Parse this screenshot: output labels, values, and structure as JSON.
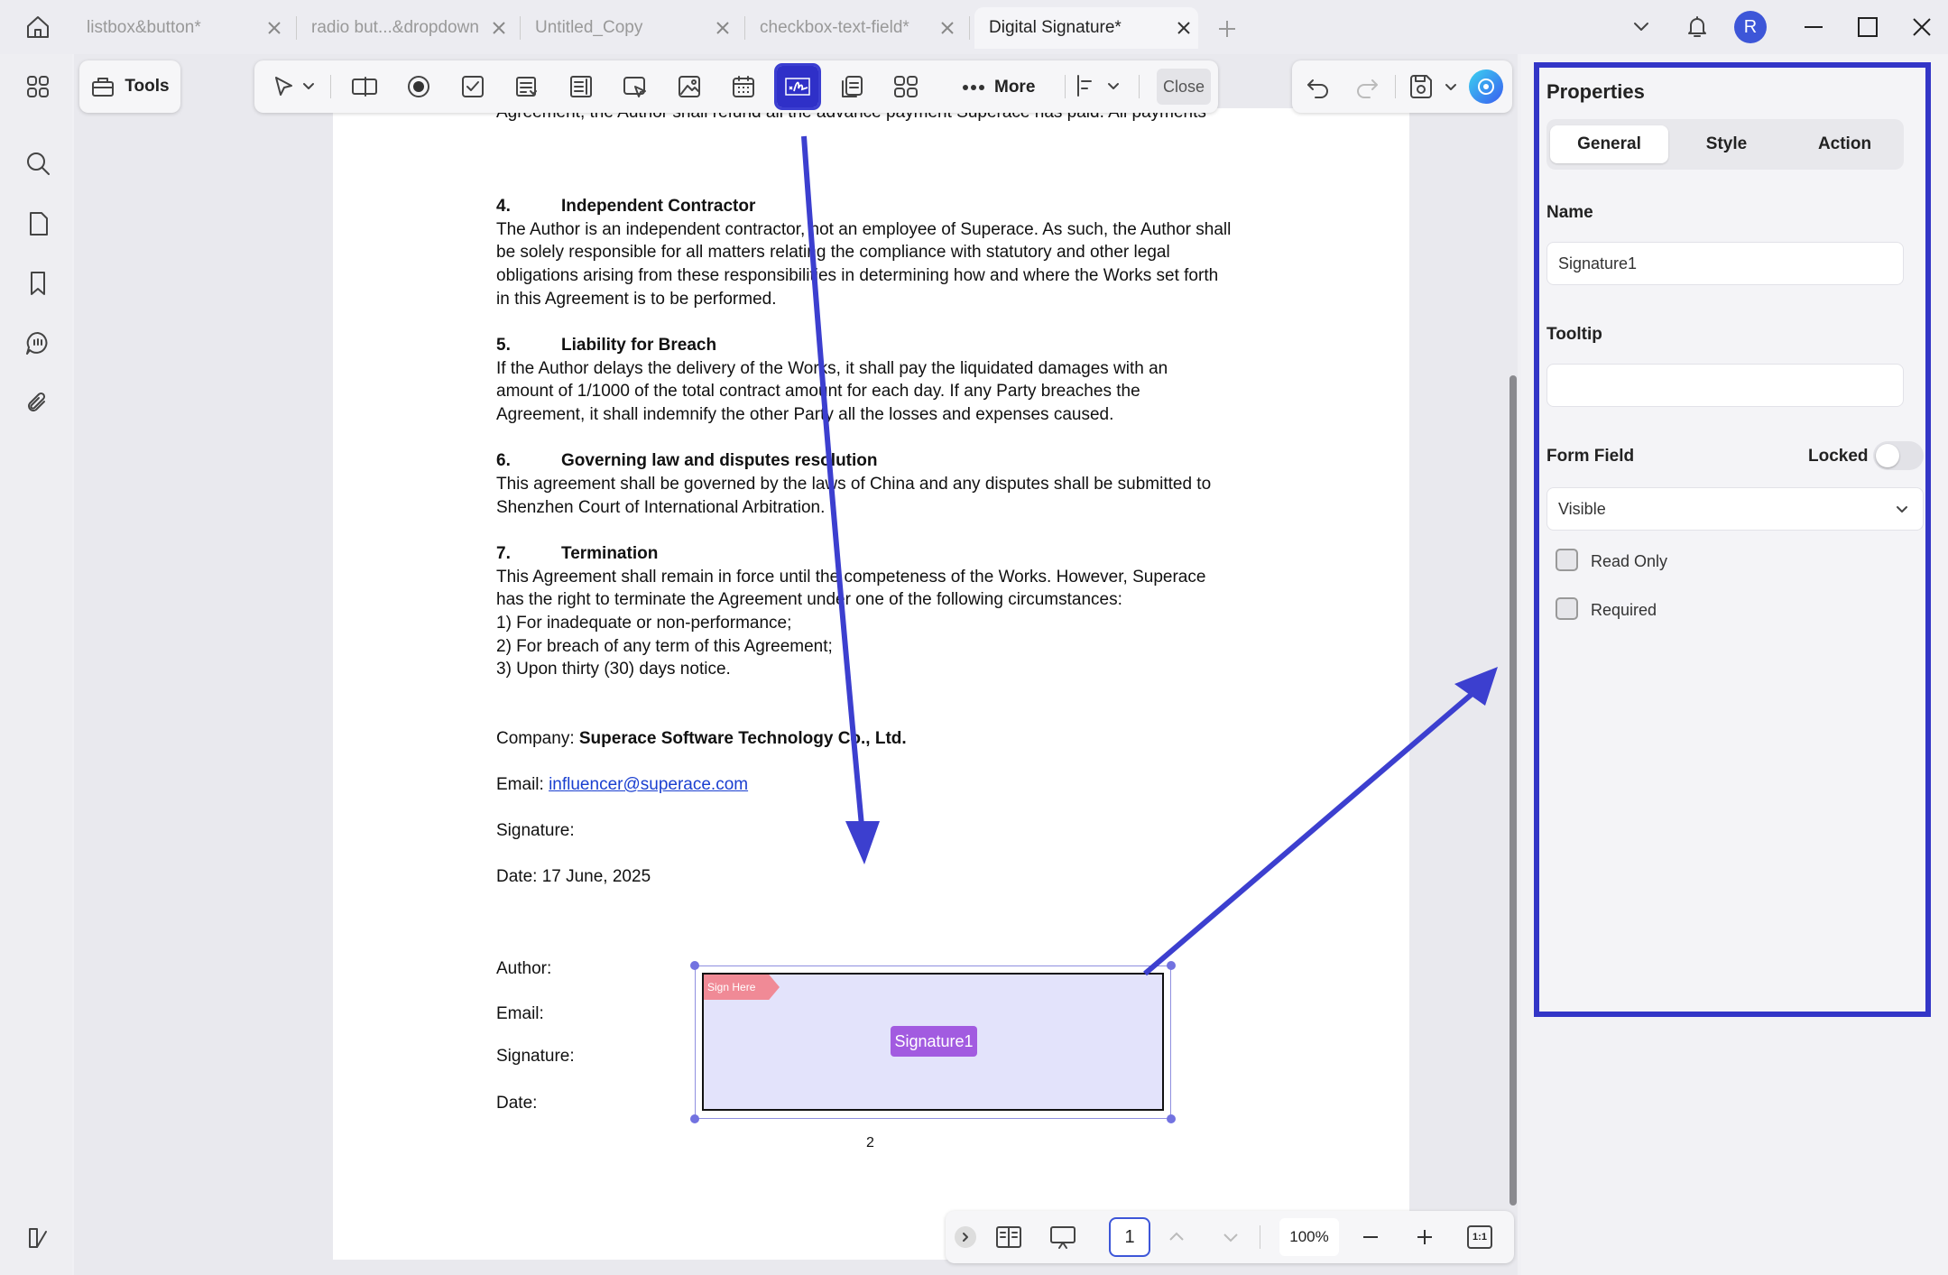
{
  "tabs": [
    {
      "label": "listbox&button*",
      "active": false
    },
    {
      "label": "radio but...&dropdown",
      "active": false
    },
    {
      "label": "Untitled_Copy",
      "active": false
    },
    {
      "label": "checkbox-text-field*",
      "active": false
    },
    {
      "label": "Digital Signature*",
      "active": true
    }
  ],
  "window": {
    "avatar_letter": "R"
  },
  "tools": {
    "tools_label": "Tools",
    "more_label": "More",
    "close_label": "Close"
  },
  "document": {
    "clipped_top": "Agreement, the Author shall refund all the advance payment Superace has paid. All payments",
    "s4_num": "4.",
    "s4_title": "Independent Contractor",
    "s4_l1": "The Author is an independent contractor, not an employee of Superace. As such, the Author shall",
    "s4_l2": "be solely responsible for all matters relating the compliance with statutory and other legal",
    "s4_l3": "obligations arising from these responsibilities in determining how and where the Works set forth",
    "s4_l4": "in this Agreement is to be performed.",
    "s5_num": "5.",
    "s5_title": "Liability for Breach",
    "s5_l1": "If the Author delays the delivery of the Works, it shall pay the liquidated damages with an",
    "s5_l2": "amount of 1/1000 of the total contract amount for each day. If any Party breaches the",
    "s5_l3": "Agreement, it shall indemnify the other Party all the losses and expenses caused.",
    "s6_num": "6.",
    "s6_title": "Governing law and disputes resolution",
    "s6_l1": "This agreement shall be governed by the laws of China and any disputes shall be submitted to",
    "s6_l2": "Shenzhen Court of International Arbitration.",
    "s7_num": "7.",
    "s7_title": "Termination",
    "s7_l1": "This Agreement shall remain in force until the competeness of the Works. However, Superace",
    "s7_l2": "has the right to terminate the Agreement under one of the following circumstances:",
    "s7_l3": "1) For inadequate or non-performance;",
    "s7_l4": "2) For breach of any term of this Agreement;",
    "s7_l5": "3)  Upon thirty (30) days notice.",
    "company_label": "Company: ",
    "company_value": "Superace Software Technology Co., Ltd.",
    "email_label": "Email: ",
    "email_value": "influencer@superace.com",
    "signature_label": "Signature:",
    "date_line": "Date: 17 June, 2025",
    "author_label": "Author:",
    "author_email_label": "Email:",
    "author_signature_label": "Signature:",
    "author_date_label": "Date:",
    "sign_here_tag": "Sign Here",
    "field_name_chip": "Signature1",
    "page_number": "2"
  },
  "bottom": {
    "current_page": "1",
    "zoom": "100%",
    "fit_label": "1:1"
  },
  "properties": {
    "title": "Properties",
    "tabs": [
      "General",
      "Style",
      "Action"
    ],
    "active_tab": "General",
    "name_label": "Name",
    "name_value": "Signature1",
    "tooltip_label": "Tooltip",
    "tooltip_value": "",
    "form_field_label": "Form Field",
    "locked_label": "Locked",
    "locked": false,
    "visibility_value": "Visible",
    "read_only_label": "Read Only",
    "read_only": false,
    "required_label": "Required",
    "required": false
  },
  "colors": {
    "accent": "#3336c7",
    "signature_fill": "#e3e3fb",
    "chip": "#a25be0",
    "tag": "#f08a96",
    "link": "#1a3fd0"
  }
}
